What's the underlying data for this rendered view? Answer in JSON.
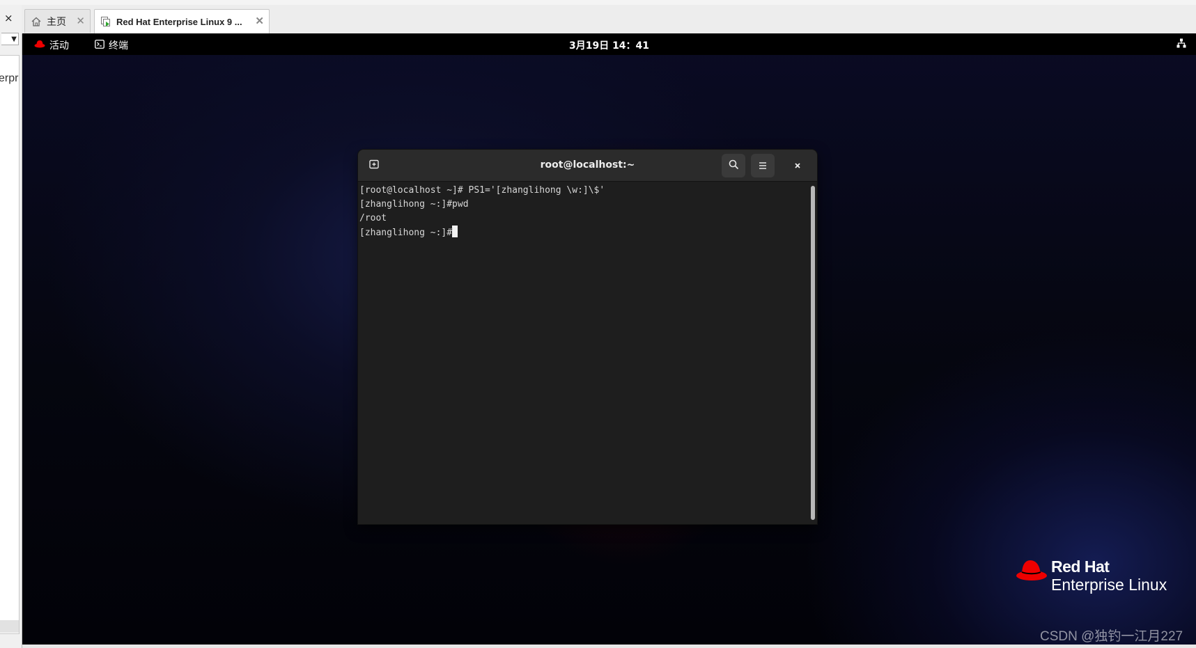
{
  "left_panel": {
    "close_glyph": "×",
    "document_text": "erpr"
  },
  "tabs": [
    {
      "label": "主页",
      "icon": "home-icon"
    },
    {
      "label": "Red Hat Enterprise Linux 9 ...",
      "icon": "vm-icon"
    }
  ],
  "gnome": {
    "activities_label": "活动",
    "app_label": "终端",
    "clock": "3月19日 14：41",
    "activities_icon": "redhat-fedora-icon",
    "app_icon": "terminal-icon",
    "status_icon": "network-wired-icon"
  },
  "terminal": {
    "title": "root@localhost:~",
    "lines": [
      "[root@localhost ~]# PS1='[zhanglihong \\w:]\\$'",
      "[zhanglihong ~:]#pwd",
      "/root",
      "[zhanglihong ~:]#"
    ]
  },
  "branding": {
    "line1": "Red Hat",
    "line2": "Enterprise Linux"
  },
  "watermark": "CSDN @独钓一江月227",
  "colors": {
    "redhat_red": "#ee0000",
    "terminal_bg": "#1e1e1e",
    "header_bg": "#2b2b2b"
  }
}
